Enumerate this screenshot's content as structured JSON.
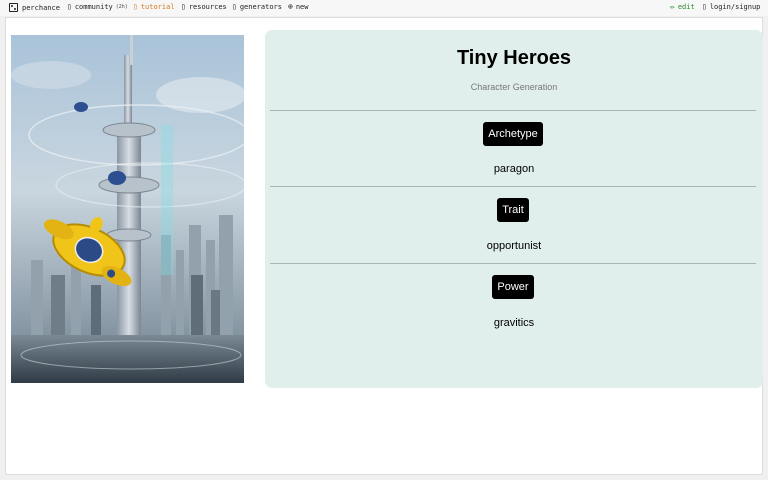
{
  "nav": {
    "brand": "perchance",
    "community": "community",
    "community_badge": "(2h)",
    "tutorial": "tutorial",
    "resources": "resources",
    "generators": "generators",
    "new": "new",
    "edit": "edit",
    "login": "login/signup"
  },
  "generator": {
    "title": "Tiny Heroes",
    "subtitle": "Character Generation",
    "sections": [
      {
        "button": "Archetype",
        "result": "paragon"
      },
      {
        "button": "Trait",
        "result": "opportunist"
      },
      {
        "button": "Power",
        "result": "gravitics"
      }
    ]
  },
  "colors": {
    "card_bg": "#e1efec",
    "tutorial": "#d2791e",
    "edit": "#2a8a2a",
    "button_bg": "#000000"
  }
}
